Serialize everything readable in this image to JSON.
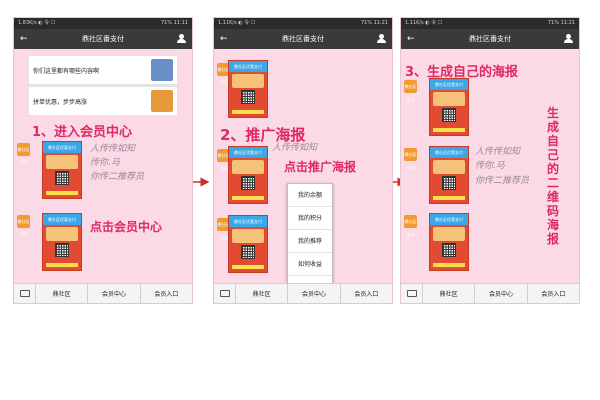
{
  "phones": [
    {
      "status_left": "1.83K/s ◐ 令 ☐",
      "status_right": "71% 11:11",
      "title": "鼎社区番支付",
      "cards": [
        {
          "text": "你们这里都有哪些内容啊"
        },
        {
          "text": "拼单优惠，步步高涨"
        }
      ],
      "step_label": "1、进入会员中心",
      "note": "点击会员中心",
      "menu": [
        "鼎社区",
        "会员中心",
        "会员入口"
      ]
    },
    {
      "status_left": "1.11K/s ◐ 令 ☐",
      "status_right": "71% 11:21",
      "title": "鼎社区番支付",
      "step_label": "2、推广海报",
      "note": "点击推广海报",
      "popup": [
        "我的余额",
        "我的积分",
        "我的推荐",
        "如何收益",
        "推广海报"
      ],
      "menu": [
        "鼎社区",
        "会员中心",
        "会员入口"
      ]
    },
    {
      "status_left": "1.11K/s ◐ 令 ☐",
      "status_right": "71% 11:21",
      "title": "鼎社区番支付",
      "step_label": "3、生成自己的海报",
      "note_vertical": "生成自己的二维码海报",
      "menu": [
        "鼎社区",
        "会员中心",
        "会员入口"
      ]
    }
  ],
  "poster_badge": "鼎社区活动",
  "poster_title": "鼎社区优惠支付",
  "handwriting": [
    "人传传如知",
    "传你.马",
    "你传二推荐员"
  ],
  "colors": {
    "accent": "#e02864",
    "background": "#fbd9e6",
    "header": "#3a3a3a",
    "poster": "#e24b32"
  }
}
